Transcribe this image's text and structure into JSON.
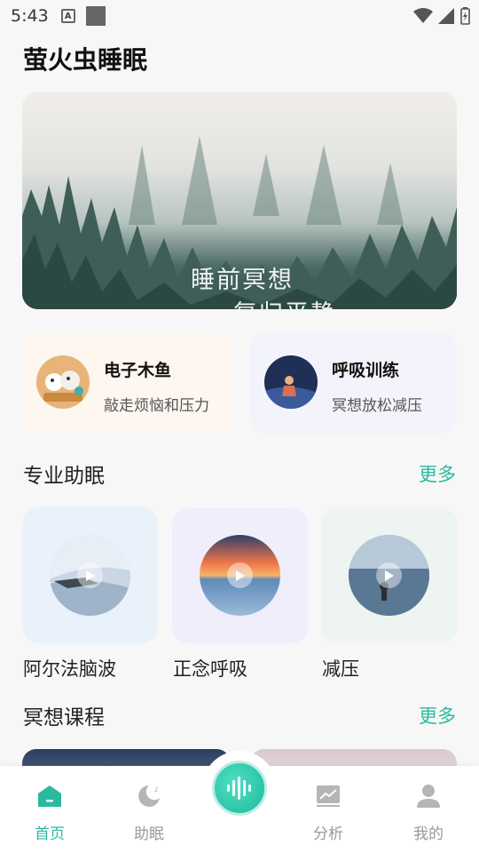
{
  "status_bar": {
    "time": "5:43",
    "icon_a": "A"
  },
  "app": {
    "title": "萤火虫睡眠"
  },
  "banner": {
    "line1": "睡前冥想",
    "line2": "复归平静"
  },
  "features": [
    {
      "title": "电子木鱼",
      "subtitle": "敲走烦恼和压力"
    },
    {
      "title": "呼吸训练",
      "subtitle": "冥想放松减压"
    }
  ],
  "sleep_section": {
    "title": "专业助眠",
    "more": "更多",
    "items": [
      {
        "label": "阿尔法脑波"
      },
      {
        "label": "正念呼吸"
      },
      {
        "label": "减压"
      }
    ]
  },
  "course_section": {
    "title": "冥想课程",
    "more": "更多"
  },
  "tabbar": {
    "tabs": [
      {
        "label": "首页",
        "icon": "home-icon",
        "active": true
      },
      {
        "label": "助眠",
        "icon": "moon-icon",
        "active": false
      },
      {
        "label": "分析",
        "icon": "chart-icon",
        "active": false
      },
      {
        "label": "我的",
        "icon": "user-icon",
        "active": false
      }
    ],
    "center_icon": "sound-wave-icon"
  },
  "colors": {
    "accent": "#2bb99f"
  }
}
